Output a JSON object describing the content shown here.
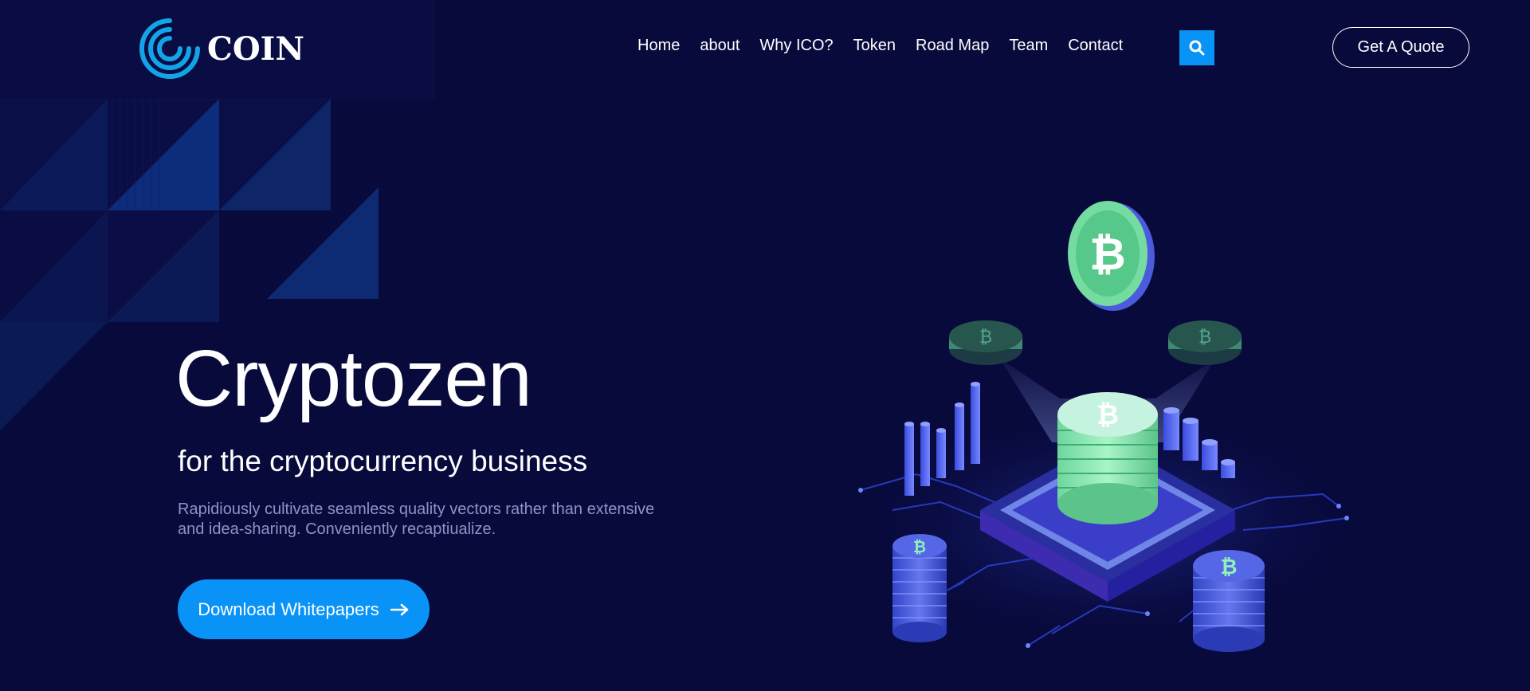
{
  "brand": {
    "name": "COIN"
  },
  "nav": {
    "items": [
      {
        "label": "Home"
      },
      {
        "label": "about"
      },
      {
        "label": "Why ICO?"
      },
      {
        "label": "Token"
      },
      {
        "label": "Road Map"
      },
      {
        "label": "Team"
      },
      {
        "label": "Contact"
      }
    ]
  },
  "header": {
    "quote_label": "Get A Quote"
  },
  "hero": {
    "title": "Cryptozen",
    "subtitle": "for the cryptocurrency business",
    "description": "Rapidiously cultivate seamless quality vectors rather than extensive and idea-sharing. Conveniently recaptiualize.",
    "cta_label": "Download Whitepapers"
  },
  "icons": {
    "logo": "spiral-logo-icon",
    "search": "search-icon",
    "cta_arrow": "arrow-right-icon",
    "illustration": "isometric-crypto-coins-illustration"
  },
  "colors": {
    "background": "#080a3c",
    "accent": "#0a93f7",
    "muted_text": "#8d93c8",
    "coin_green": "#7be0a4",
    "coin_blue": "#4b5bdc"
  }
}
